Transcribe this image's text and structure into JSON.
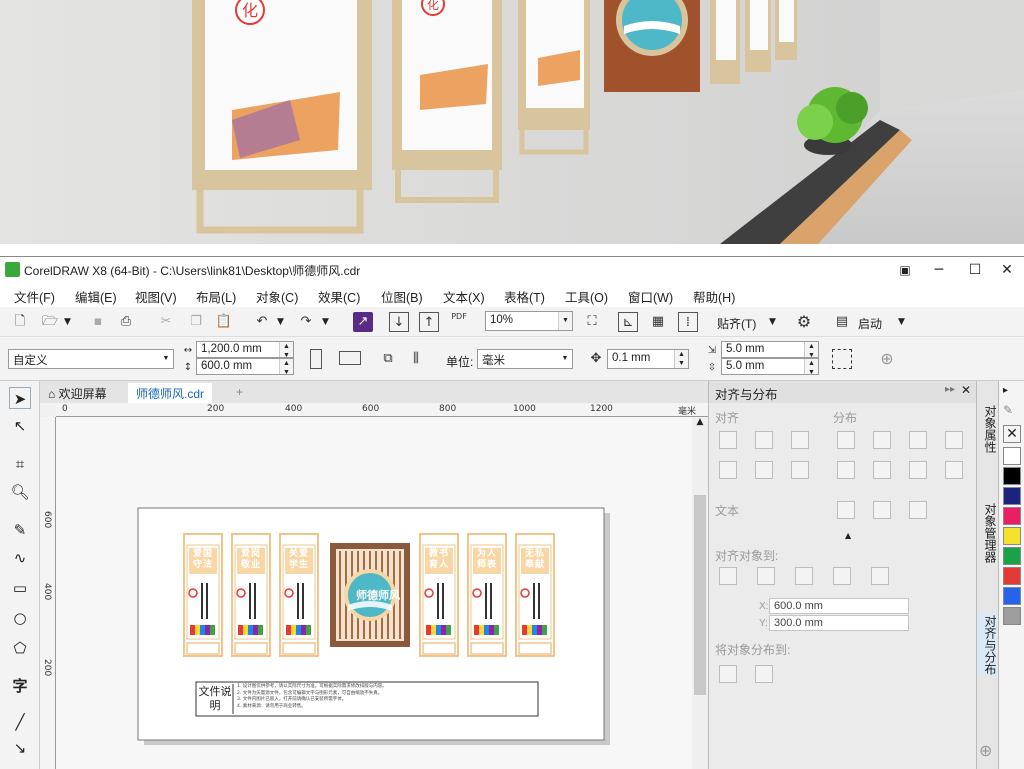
{
  "window": {
    "title": "CorelDRAW X8 (64-Bit) - C:\\Users\\link81\\Desktop\\师德师风.cdr",
    "minimize": "─",
    "maximize": "☐",
    "close": "✕"
  },
  "menu": [
    "文件(F)",
    "编辑(E)",
    "视图(V)",
    "布局(L)",
    "对象(C)",
    "效果(C)",
    "位图(B)",
    "文本(X)",
    "表格(T)",
    "工具(O)",
    "窗口(W)",
    "帮助(H)"
  ],
  "toolbar": {
    "zoom": "10%",
    "snap_label": "贴齐(T)",
    "launch_label": "启动"
  },
  "propbar": {
    "page_preset": "自定义",
    "width": "1,200.0 mm",
    "height": "600.0 mm",
    "units_label": "单位:",
    "units_value": "毫米",
    "nudge": "0.1 mm",
    "dup_x": "5.0 mm",
    "dup_y": "5.0 mm"
  },
  "tabs": {
    "welcome": "欢迎屏幕",
    "document": "师德师风.cdr",
    "add": "+"
  },
  "ruler": {
    "h_ticks": [
      "0",
      "200",
      "400",
      "600",
      "800",
      "1000",
      "1200"
    ],
    "unit": "毫米",
    "v_ticks": [
      "600",
      "400",
      "200"
    ]
  },
  "design": {
    "panels": [
      {
        "caption": "爱国守法"
      },
      {
        "caption": "爱岗敬业"
      },
      {
        "caption": "关爱学生"
      },
      {
        "caption": "教书育人"
      },
      {
        "caption": "为人师表"
      },
      {
        "caption": "无私奉献"
      }
    ],
    "center_title": "师德师风",
    "note_label": "文件说明",
    "note_lines": [
      "1. 设计图仅供参考，请以实际尺寸为准，可根据实际需求修改排版与内容。",
      "2. 文件为矢量源文件，包含可编辑文字与图形元素，可自由缩放不失真。",
      "3. 文件内图片已嵌入，打开前请确认已安装所需字体。",
      "4. 素材来源：请勿用于商业转售。"
    ]
  },
  "hero": {
    "frames": [
      {
        "glyph": "化"
      },
      {
        "glyph": "化"
      }
    ]
  },
  "docker": {
    "title": "对齐与分布",
    "align": "对齐",
    "distribute": "分布",
    "text": "文本",
    "align_to": "对齐对象到:",
    "x": "600.0 mm",
    "y": "300.0 mm",
    "distribute_to": "将对象分布到:"
  },
  "side_tabs": [
    "对象属性",
    "对象管理器",
    "对齐与分布"
  ],
  "palette": [
    "#ffffff",
    "#000000",
    "#1a237e",
    "#e91e63",
    "#f5e12a",
    "#16a34a",
    "#e53935",
    "#2563eb",
    "#9e9e9e"
  ],
  "colors": {
    "accent": "#3aa83a",
    "panel_fill": "#f7d7a6",
    "frame_brown": "#8b5a3c",
    "teal": "#4fb8c8"
  }
}
